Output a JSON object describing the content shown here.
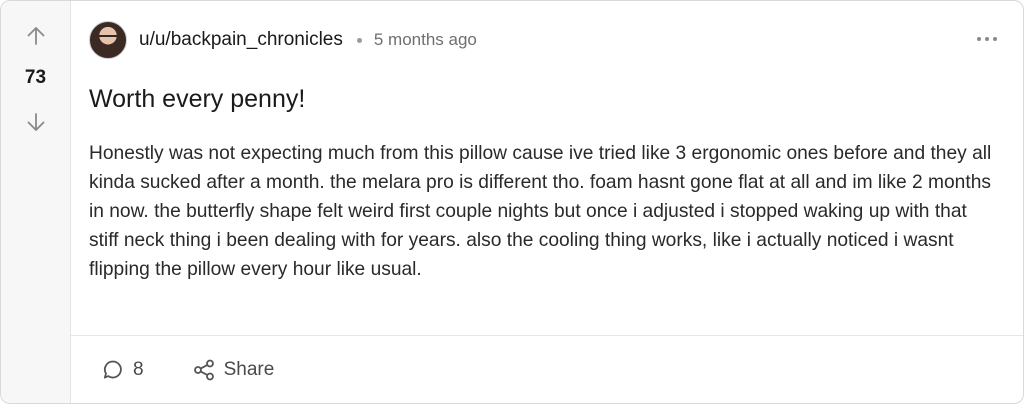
{
  "post": {
    "score": "73",
    "username": "u/u/backpain_chronicles",
    "separator": "•",
    "time_ago": "5 months ago",
    "title": "Worth every penny!",
    "body": "Honestly was not expecting much from this pillow cause ive tried like 3 ergonomic ones before and they all kinda sucked after a month. the melara pro is different tho. foam hasnt gone flat at all and im like 2 months in now. the butterfly shape felt weird first couple nights but once i adjusted i stopped waking up with that stiff neck thing i been dealing with for years. also the cooling thing works, like i actually noticed i wasnt flipping the pillow every hour like usual.",
    "comments_count": "8",
    "share_label": "Share"
  },
  "icons": {
    "upvote": "arrow-up-icon",
    "downvote": "arrow-down-icon",
    "more": "more-horizontal-icon",
    "comment": "comment-bubble-icon",
    "share": "share-nodes-icon",
    "avatar": "user-avatar"
  },
  "colors": {
    "vote_column_bg": "#f7f7f7",
    "text_primary": "#1a1a1a",
    "text_secondary": "#6f6f6f",
    "border": "#d9d9d9"
  }
}
